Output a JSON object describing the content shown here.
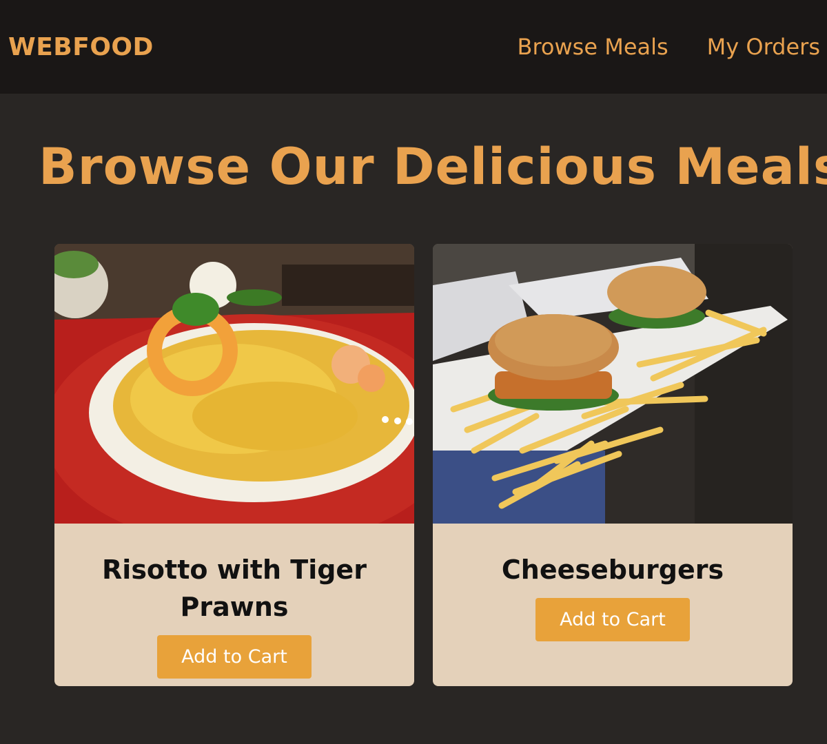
{
  "header": {
    "brand": "WEBFOOD",
    "nav": [
      {
        "label": "Browse Meals"
      },
      {
        "label": "My Orders"
      }
    ]
  },
  "main": {
    "title": "Browse Our Delicious Meals",
    "meals": [
      {
        "name": "Risotto with Tiger Prawns",
        "button_label": "Add to Cart"
      },
      {
        "name": "Cheeseburgers",
        "button_label": "Add to Cart"
      }
    ]
  },
  "colors": {
    "accent": "#e9a24f",
    "button": "#e8a23a",
    "header_bg": "#1a1716",
    "page_bg": "#292624",
    "card_bg": "#e4d1ba"
  }
}
